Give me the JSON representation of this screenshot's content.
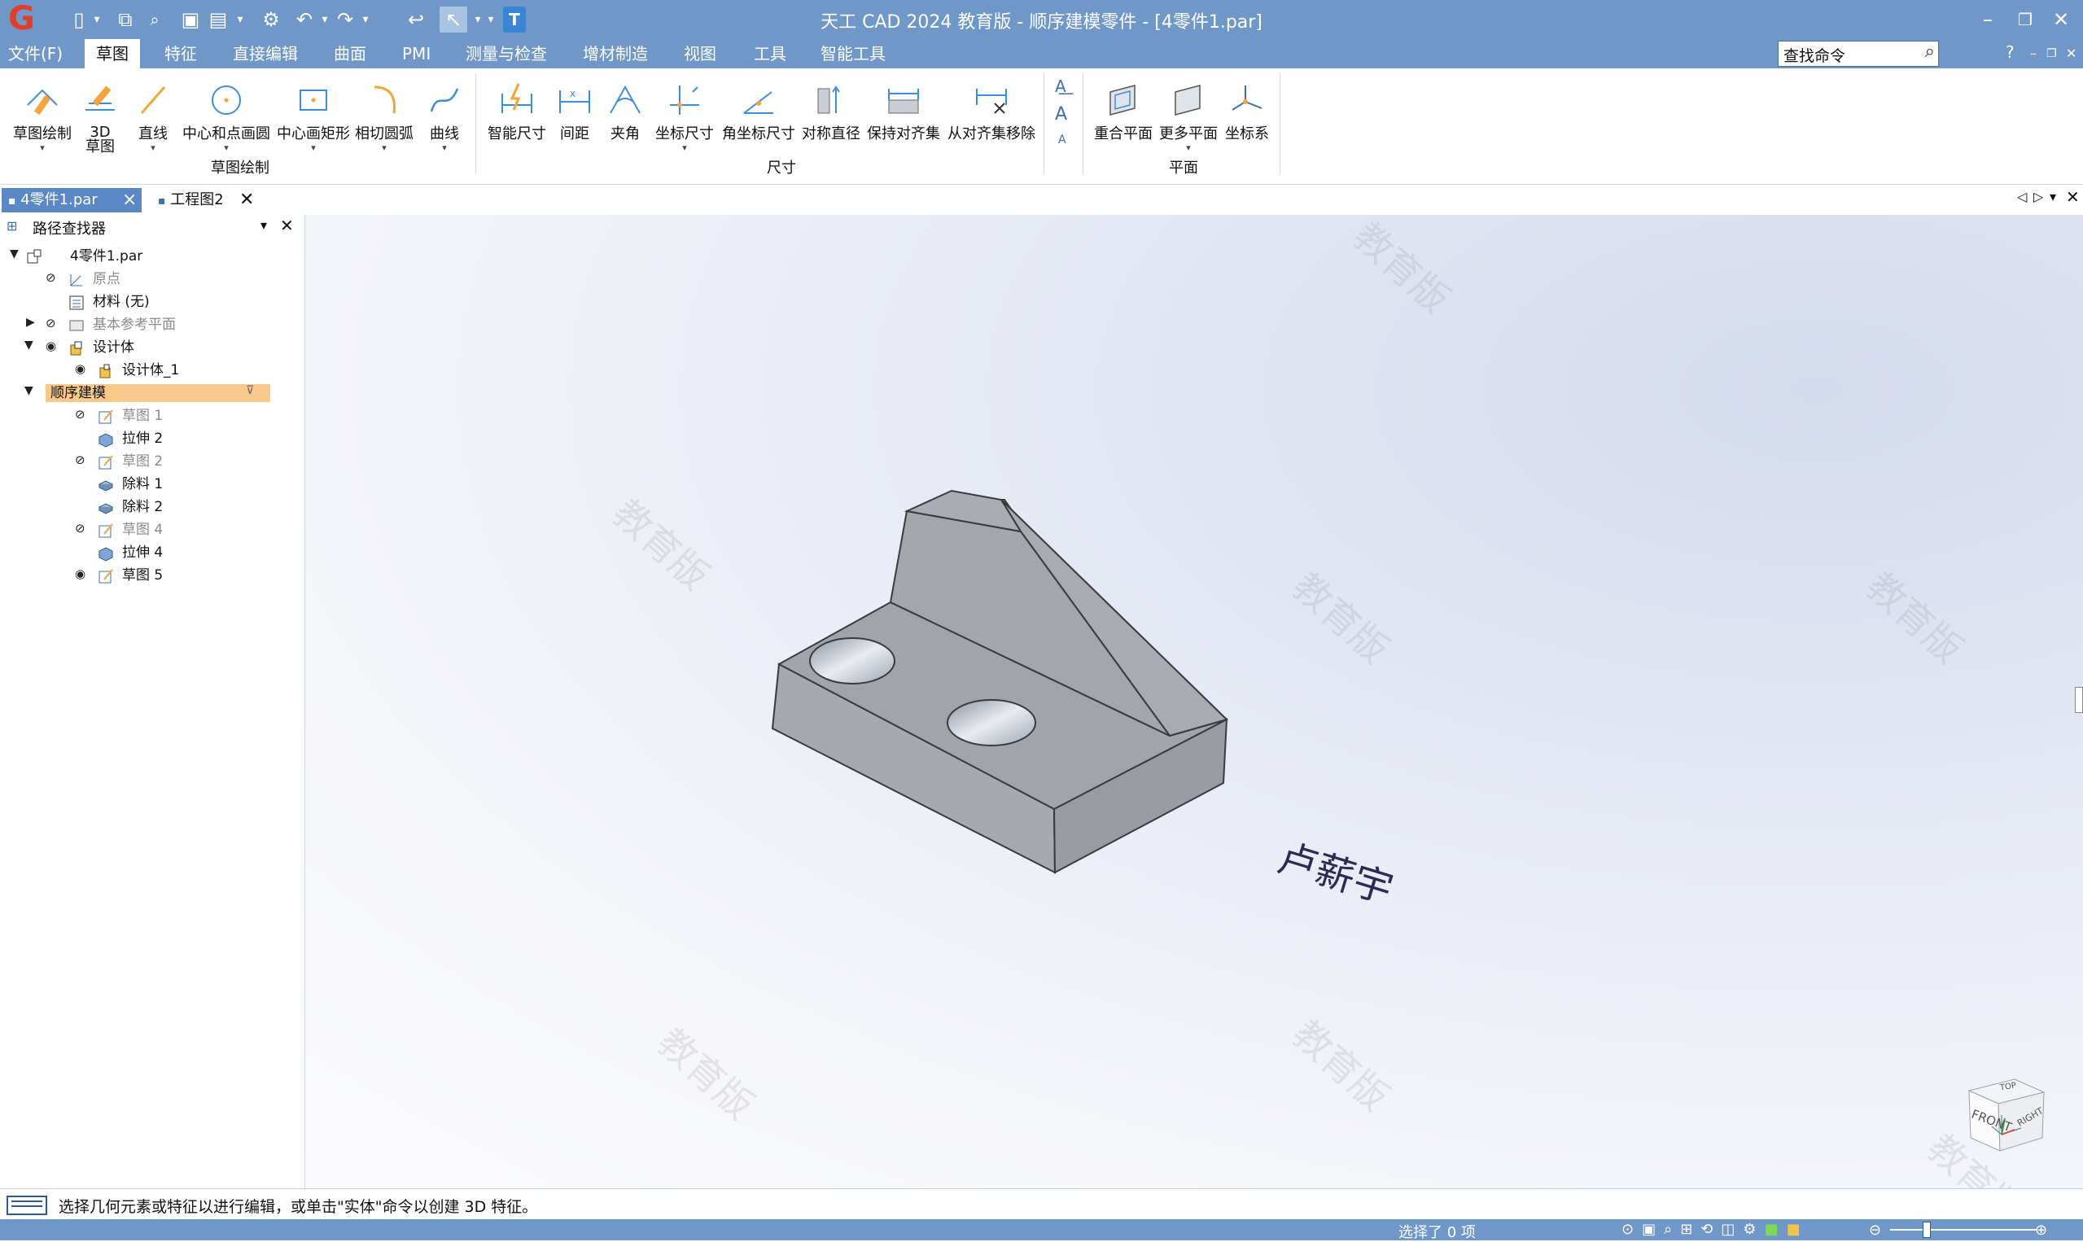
{
  "window": {
    "title": "天工 CAD 2024 教育版 - 顺序建模零件 - [4零件1.par]"
  },
  "quick_access": [
    "new-doc",
    "open",
    "find",
    "save",
    "save-as",
    "options",
    "undo",
    "redo",
    "back",
    "select",
    "text"
  ],
  "menu": {
    "items": [
      "文件(F)",
      "草图",
      "特征",
      "直接编辑",
      "曲面",
      "PMI",
      "测量与检查",
      "增材制造",
      "视图",
      "工具",
      "智能工具"
    ],
    "active": "草图"
  },
  "search": {
    "value": "查找命令"
  },
  "ribbon": {
    "sketch_group": {
      "label": "草图绘制",
      "buttons": [
        "草图绘制",
        "3D\n草图",
        "直线",
        "中心和点画圆",
        "中心画矩形",
        "相切圆弧",
        "曲线"
      ]
    },
    "dim_group": {
      "label": "尺寸",
      "buttons": [
        "智能尺寸",
        "间距",
        "夹角",
        "坐标尺寸",
        "角坐标尺寸",
        "对称直径",
        "保持对齐集",
        "从对齐集移除"
      ]
    },
    "plane_group": {
      "label": "平面",
      "buttons": [
        "重合平面",
        "更多平面",
        "坐标系"
      ]
    }
  },
  "doc_tabs": [
    "4零件1.par",
    "工程图2"
  ],
  "pathfinder": {
    "title": "路径查找器",
    "tree": [
      {
        "label": "4零件1.par",
        "level": 0
      },
      {
        "label": "原点",
        "level": 1,
        "dim": true
      },
      {
        "label": "材料 (无)",
        "level": 1
      },
      {
        "label": "基本参考平面",
        "level": 1,
        "dim": true
      },
      {
        "label": "设计体",
        "level": 1
      },
      {
        "label": "设计体_1",
        "level": 2
      },
      {
        "label": "顺序建模",
        "level": 0,
        "selected": true
      },
      {
        "label": "草图 1",
        "level": 2,
        "dim": true
      },
      {
        "label": "拉伸 2",
        "level": 2
      },
      {
        "label": "草图 2",
        "level": 2,
        "dim": true
      },
      {
        "label": "除料 1",
        "level": 2
      },
      {
        "label": "除料 2",
        "level": 2
      },
      {
        "label": "草图 4",
        "level": 2,
        "dim": true
      },
      {
        "label": "拉伸 4",
        "level": 2
      },
      {
        "label": "草图 5",
        "level": 2
      }
    ]
  },
  "viewport": {
    "watermark": "教育版",
    "signature": "卢薪宇",
    "view_cube": {
      "front": "FRONT",
      "right": "RIGHT",
      "top": "TOP"
    }
  },
  "status": {
    "prompt": "选择几何元素或特征以进行编辑，或单击\"实体\"命令以创建 3D 特征。",
    "selection": "选择了 0 项"
  },
  "colors": {
    "chrome": "#6f97c8",
    "active_tab": "#5a88c6",
    "selected_row": "#f9c98a",
    "part_face": "#a3a6ab"
  }
}
